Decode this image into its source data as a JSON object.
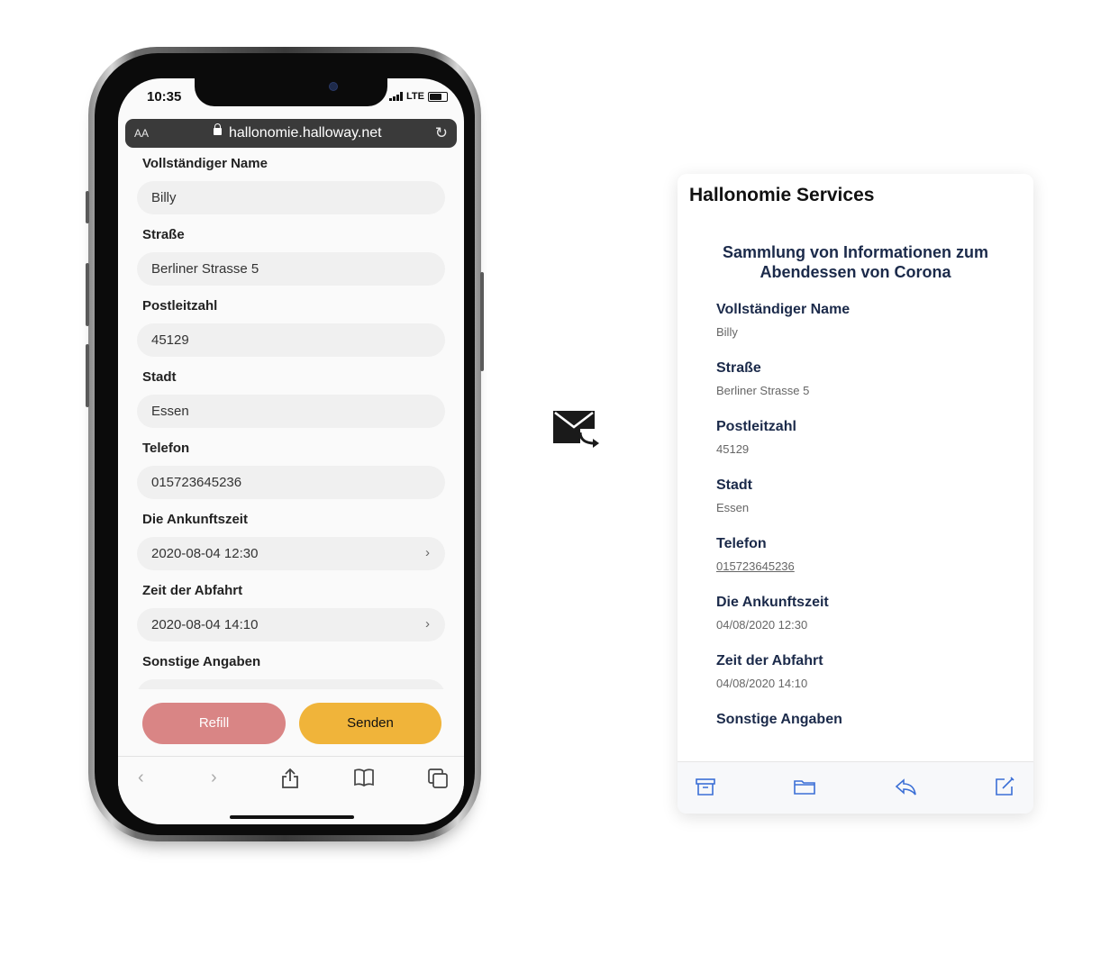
{
  "phone": {
    "status": {
      "time": "10:35",
      "network": "LTE"
    },
    "browser": {
      "text_size": "AA",
      "url": "hallonomie.halloway.net"
    },
    "form": {
      "fields": [
        {
          "label": "Vollständiger Name",
          "value": "Billy"
        },
        {
          "label": "Straße",
          "value": "Berliner Strasse 5"
        },
        {
          "label": "Postleitzahl",
          "value": "45129"
        },
        {
          "label": "Stadt",
          "value": "Essen"
        },
        {
          "label": "Telefon",
          "value": "015723645236"
        },
        {
          "label": "Die Ankunftszeit",
          "value": "2020-08-04 12:30"
        },
        {
          "label": "Zeit der Abfahrt",
          "value": "2020-08-04 14:10"
        },
        {
          "label": "Sonstige Angaben",
          "value": ""
        }
      ],
      "refill_label": "Refill",
      "send_label": "Senden"
    },
    "toolbar": [
      "back-icon",
      "forward-icon",
      "share-icon",
      "bookmarks-icon",
      "tabs-icon"
    ]
  },
  "email": {
    "sender": "Hallonomie Services",
    "heading": "Sammlung von Informationen zum Abendessen von Corona",
    "items": [
      {
        "label": "Vollständiger Name",
        "value": "Billy"
      },
      {
        "label": "Straße",
        "value": "Berliner Strasse 5"
      },
      {
        "label": "Postleitzahl",
        "value": "45129"
      },
      {
        "label": "Stadt",
        "value": "Essen"
      },
      {
        "label": "Telefon",
        "value": "015723645236"
      },
      {
        "label": "Die Ankunftszeit",
        "value": "04/08/2020 12:30"
      },
      {
        "label": "Zeit der Abfahrt",
        "value": "04/08/2020 14:10"
      },
      {
        "label": "Sonstige Angaben",
        "value": ""
      }
    ],
    "toolbar": [
      "archive-icon",
      "folder-icon",
      "reply-icon",
      "compose-icon"
    ]
  },
  "colors": {
    "refill": "#d98585",
    "send": "#f0b43a",
    "email_text": "#1b2a4a"
  }
}
